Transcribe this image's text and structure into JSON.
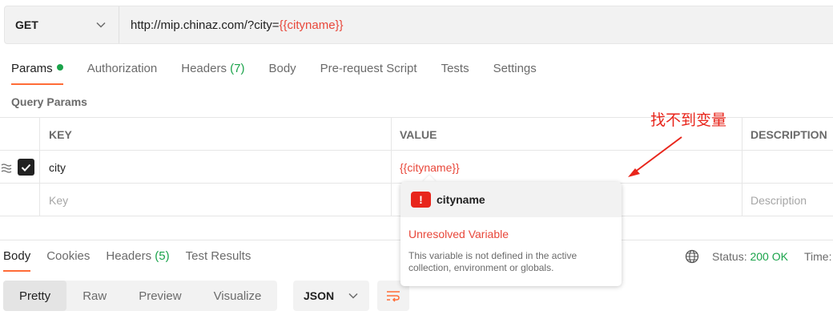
{
  "request": {
    "method": "GET",
    "url_base": "http://mip.chinaz.com/?city=",
    "url_var": "{{cityname}}"
  },
  "request_tabs": {
    "params": "Params",
    "authorization": "Authorization",
    "headers": "Headers",
    "headers_count": "(7)",
    "body": "Body",
    "pre_request_script": "Pre-request Script",
    "tests": "Tests",
    "settings": "Settings"
  },
  "query_params": {
    "section_label": "Query Params",
    "columns": {
      "key": "KEY",
      "value": "VALUE",
      "description": "DESCRIPTION"
    },
    "rows": [
      {
        "checked": true,
        "key": "city",
        "value": "{{cityname}}",
        "description": ""
      }
    ],
    "new_row": {
      "key_placeholder": "Key",
      "description_placeholder": "Description"
    }
  },
  "tooltip": {
    "variable_name": "cityname",
    "warning_symbol": "!",
    "status": "Unresolved Variable",
    "description": "This variable is not defined in the active collection, environment or globals."
  },
  "annotation": {
    "text": "找不到变量",
    "color": "#e8251b"
  },
  "response_tabs": {
    "body": "Body",
    "cookies": "Cookies",
    "headers": "Headers",
    "headers_count": "(5)",
    "test_results": "Test Results"
  },
  "response_status": {
    "status_label": "Status:",
    "status_value": "200 OK",
    "time_label": "Time:"
  },
  "body_view": {
    "modes": [
      "Pretty",
      "Raw",
      "Preview",
      "Visualize"
    ],
    "active_mode": "Pretty",
    "format": "JSON"
  },
  "colors": {
    "accent": "#ff6c37",
    "success": "#1aa34a",
    "error": "#e8473a"
  }
}
